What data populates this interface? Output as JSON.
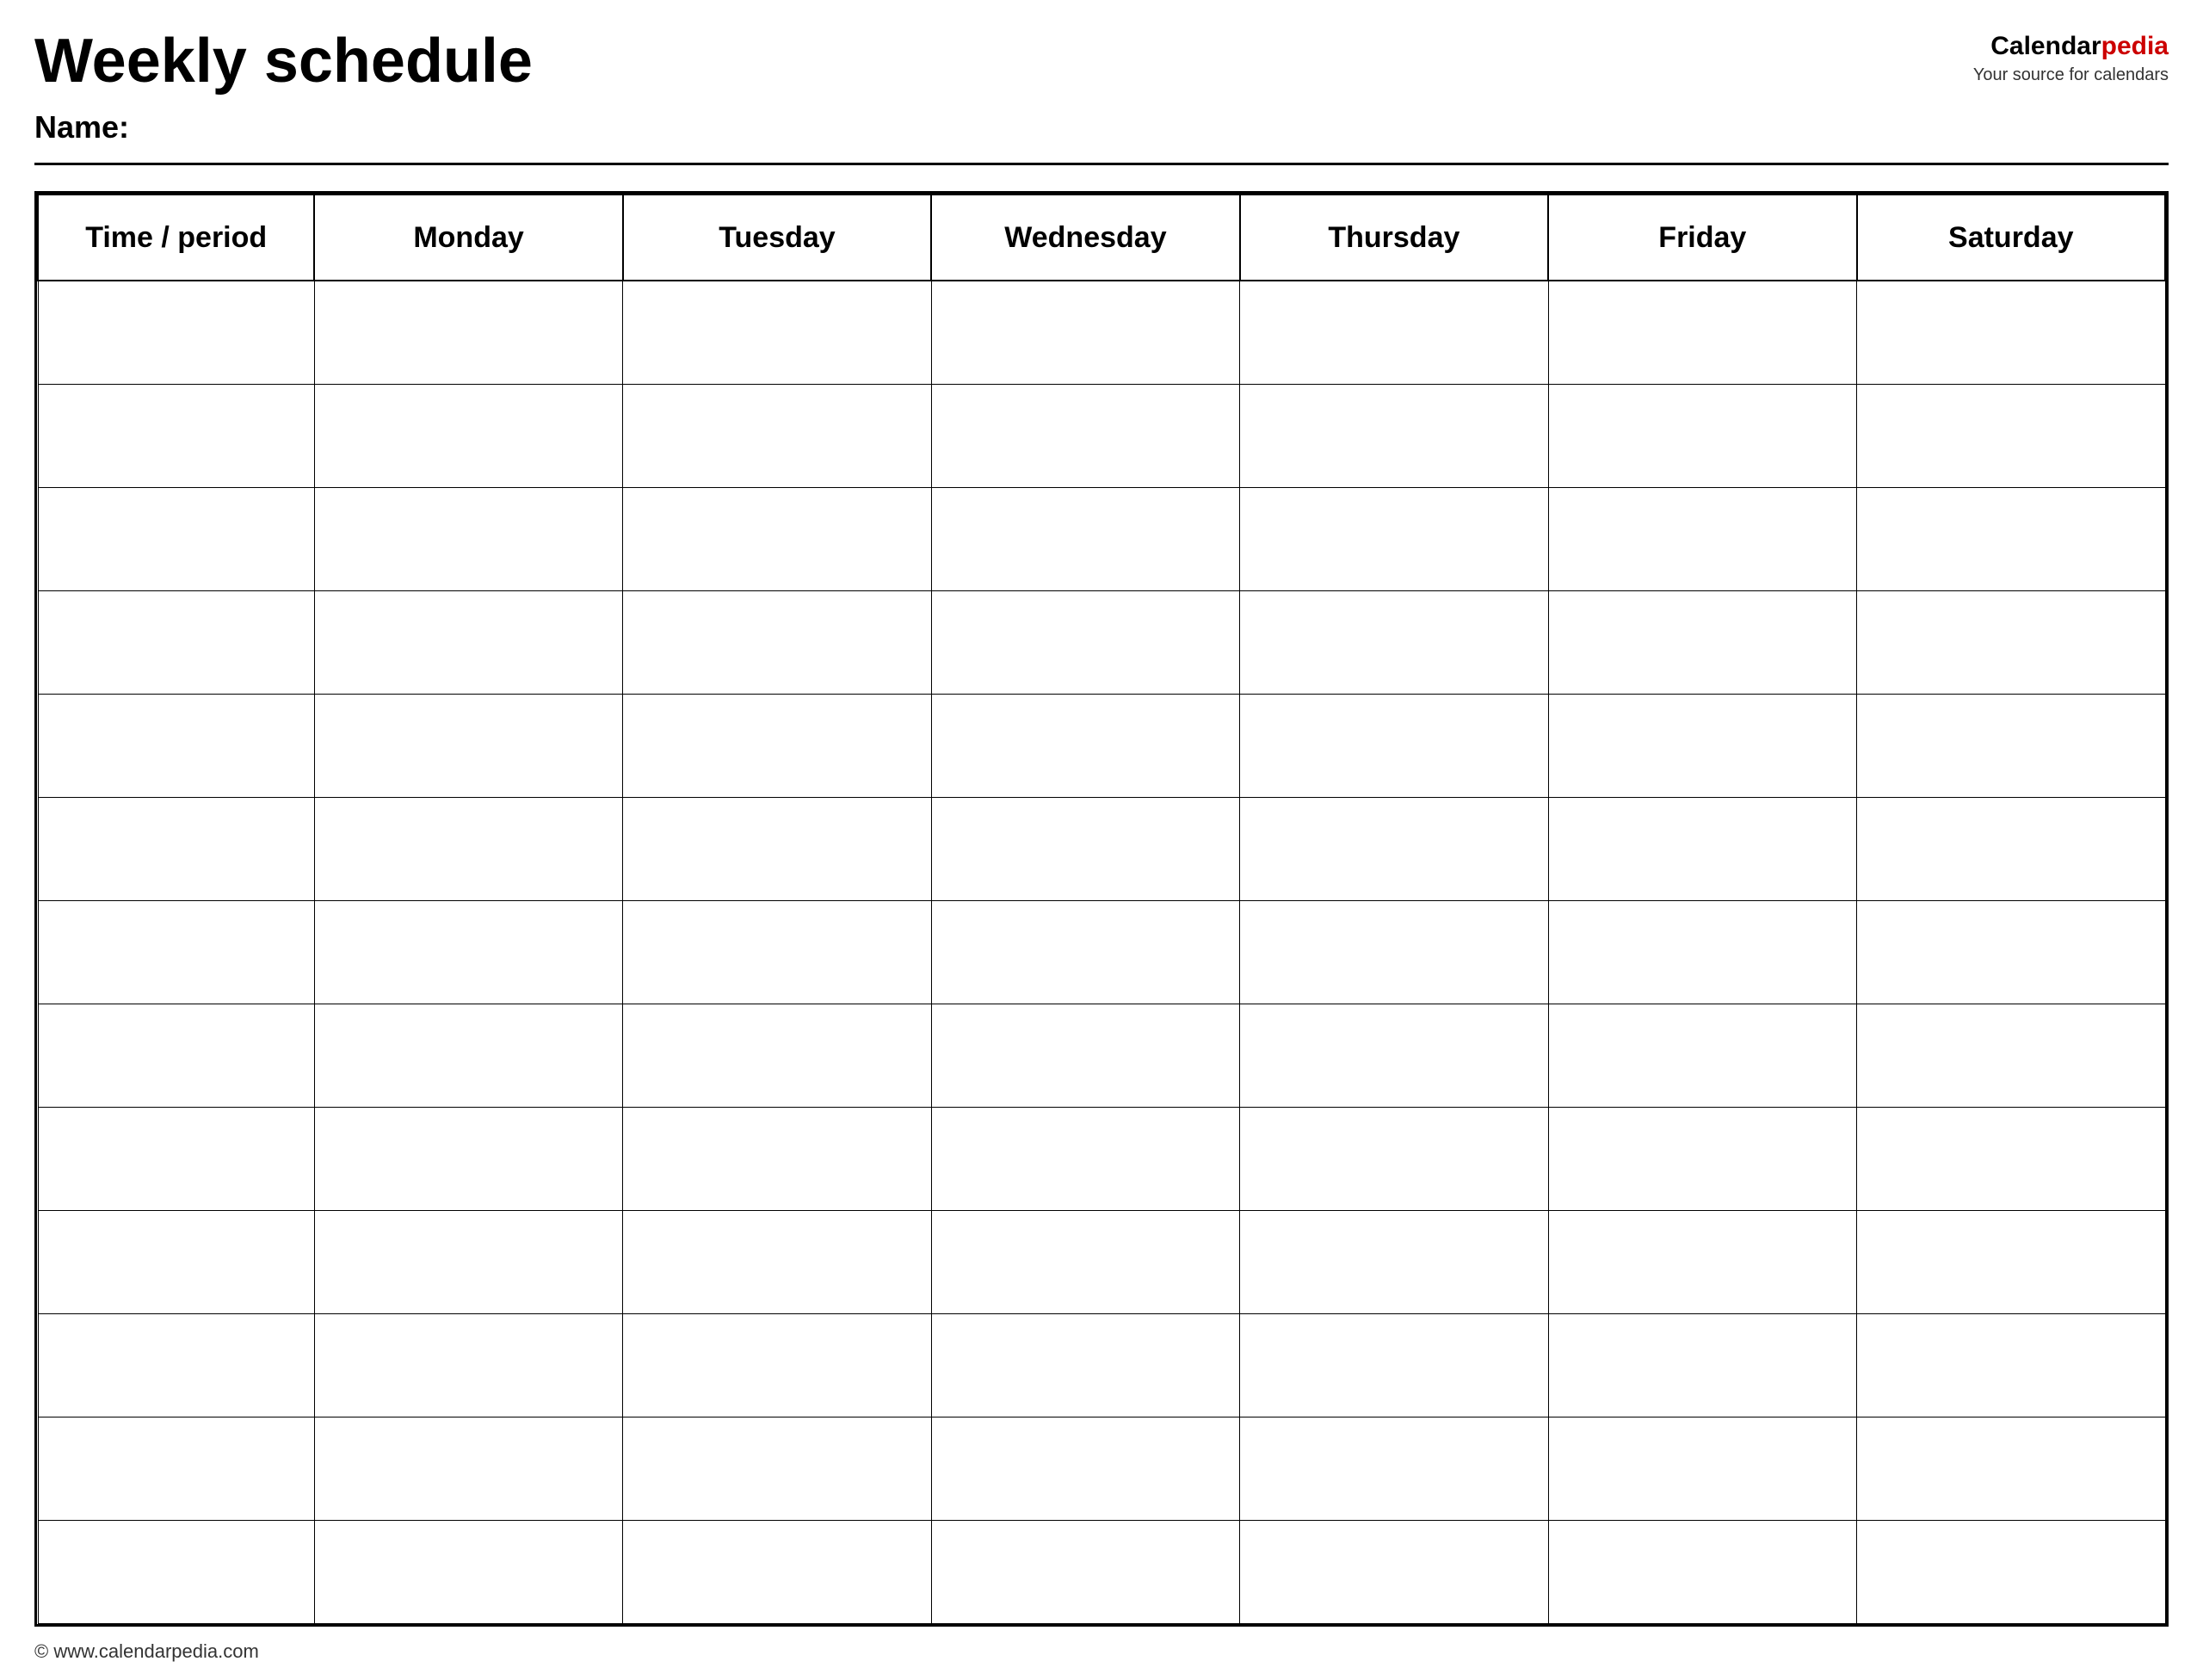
{
  "header": {
    "title": "Weekly schedule",
    "name_label": "Name:",
    "logo_part1": "Calendar",
    "logo_part2": "pedia",
    "logo_tagline": "Your source for calendars"
  },
  "table": {
    "columns": [
      {
        "label": "Time / period",
        "key": "time"
      },
      {
        "label": "Monday",
        "key": "monday"
      },
      {
        "label": "Tuesday",
        "key": "tuesday"
      },
      {
        "label": "Wednesday",
        "key": "wednesday"
      },
      {
        "label": "Thursday",
        "key": "thursday"
      },
      {
        "label": "Friday",
        "key": "friday"
      },
      {
        "label": "Saturday",
        "key": "saturday"
      }
    ],
    "row_count": 13
  },
  "footer": {
    "url": "© www.calendarpedia.com"
  }
}
